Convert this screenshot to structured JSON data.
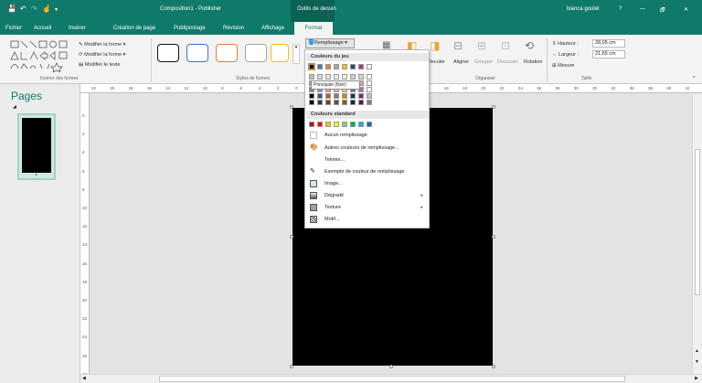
{
  "titlebar": {
    "doc_title": "Composition1 - Publisher",
    "context_tab": "Outils de dessin",
    "user": "bianca goulet",
    "help": "?",
    "minimize": "—",
    "restore": "🗗",
    "close": "✕"
  },
  "tabs": [
    "Fichier",
    "Accueil",
    "Insérer",
    "Création de page",
    "Publipostage",
    "Révision",
    "Affichage",
    "Format"
  ],
  "ribbon": {
    "modify_shape": "Modifier la forme",
    "modify_shape2": "Modifier la forme",
    "modify_text": "Modifier le texte",
    "group_insert_shapes": "Insérer des formes",
    "group_shape_styles": "Styles de formes",
    "fill_button": "Remplissage",
    "group_arrange": "Organiser",
    "reculer": "Reculer",
    "aligner": "Aligner",
    "grouper": "Grouper",
    "dissocier": "Dissocier",
    "rotation": "Rotation",
    "hauteur_label": "Hauteur :",
    "hauteur_value": "28,05 cm",
    "largeur_label": "Largeur :",
    "largeur_value": "21,65 cm",
    "mesure": "Mesure",
    "group_size": "Taille"
  },
  "pages": {
    "title": "Pages",
    "page_number": "1"
  },
  "ruler": {
    "h_ticks": [
      "22",
      "20",
      "18",
      "16",
      "14",
      "12",
      "10",
      "8",
      "6",
      "4",
      "2",
      "0",
      "2",
      "4",
      "6",
      "8",
      "10",
      "12",
      "14",
      "16",
      "18",
      "20",
      "22",
      "24",
      "26",
      "28",
      "30",
      "32",
      "34",
      "36",
      "38",
      "40",
      "42"
    ],
    "v_ticks": [
      "0",
      "2",
      "4",
      "6",
      "8",
      "10",
      "12",
      "14",
      "16",
      "18",
      "20",
      "22",
      "24",
      "26",
      "28"
    ]
  },
  "dropdown": {
    "theme_header": "Couleurs du jeu",
    "standard_header": "Couleurs standard",
    "tooltip": "Principale (Noir)",
    "items": {
      "no_fill": "Aucun remplissage",
      "more_colors": "Autres couleurs de remplissage...",
      "tints": "Teintes...",
      "eyedropper": "Exemple de couleur de remplissage",
      "image": "Image...",
      "gradient": "Dégradé",
      "texture": "Texture",
      "pattern": "Motif..."
    },
    "theme_colors": [
      "#000000",
      "#4472c4",
      "#ed7d31",
      "#a5a5a5",
      "#ffc000",
      "#264478",
      "#9e3a8a",
      "#ffffff"
    ],
    "standard_colors": [
      "#c00000",
      "#ff0000",
      "#ffc000",
      "#ffff00",
      "#92d050",
      "#00b050",
      "#00b0f0",
      "#0070c0"
    ]
  },
  "colors": {
    "accent": "#0f7a6a",
    "shape_fill": "#000000"
  }
}
